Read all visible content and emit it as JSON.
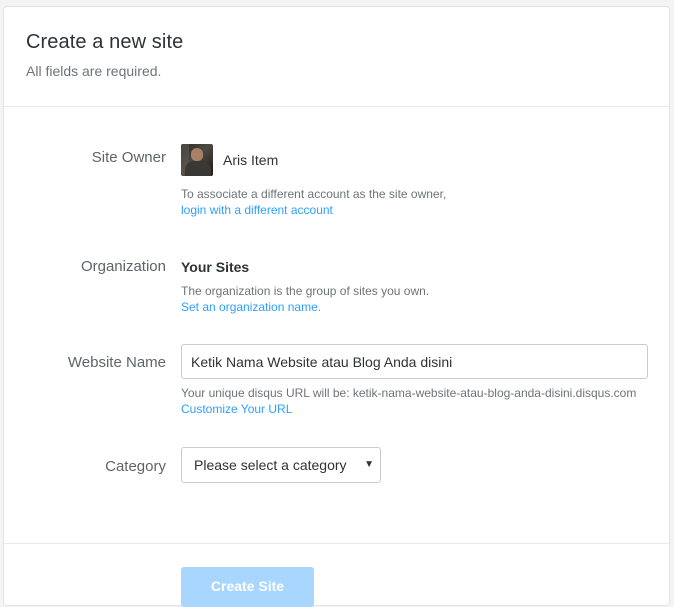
{
  "header": {
    "title": "Create a new site",
    "subtitle": "All fields are required."
  },
  "site_owner": {
    "label": "Site Owner",
    "owner_name": "Aris Item",
    "help": "To associate a different account as the site owner,",
    "link": "login with a different account"
  },
  "organization": {
    "label": "Organization",
    "value": "Your Sites",
    "help": "The organization is the group of sites you own.",
    "link": "Set an organization name."
  },
  "website_name": {
    "label": "Website Name",
    "value": "Ketik Nama Website atau Blog Anda disini",
    "url_help": "Your unique disqus URL will be: ketik-nama-website-atau-blog-anda-disini.disqus.com",
    "link": "Customize Your URL"
  },
  "category": {
    "label": "Category",
    "selected": "Please select a category",
    "arrow": "▼"
  },
  "submit": {
    "label": "Create Site",
    "color": "#a8d6ff"
  },
  "colors": {
    "accent": "#2e9fff"
  }
}
